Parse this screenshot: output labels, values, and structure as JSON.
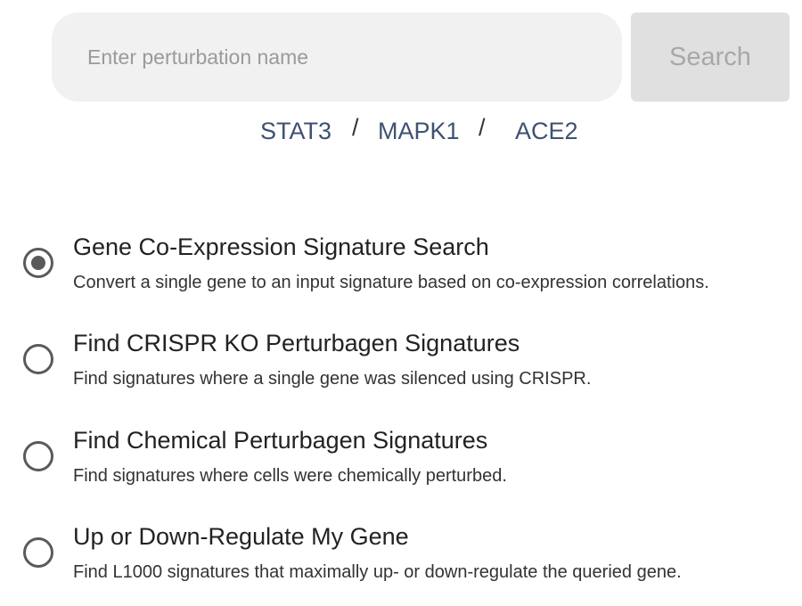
{
  "search": {
    "placeholder": "Enter perturbation name",
    "value": "",
    "button_label": "Search"
  },
  "examples": {
    "items": [
      "STAT3",
      "MAPK1",
      "ACE2"
    ],
    "separator": "/"
  },
  "options": [
    {
      "title": "Gene Co-Expression Signature Search",
      "description": "Convert a single gene to an input signature based on co-expression correlations.",
      "selected": true
    },
    {
      "title": "Find CRISPR KO Perturbagen Signatures",
      "description": "Find signatures where a single gene was silenced using CRISPR.",
      "selected": false
    },
    {
      "title": "Find Chemical Perturbagen Signatures",
      "description": "Find signatures where cells were chemically perturbed.",
      "selected": false
    },
    {
      "title": "Up or Down-Regulate My Gene",
      "description": "Find L1000 signatures that maximally up- or down-regulate the queried gene.",
      "selected": false
    }
  ],
  "colors": {
    "link": "#3d5271",
    "input_bg": "#f1f1f1",
    "button_bg": "#e0e0e0",
    "button_text": "#a8a8a8",
    "radio": "#5a5a5a"
  }
}
